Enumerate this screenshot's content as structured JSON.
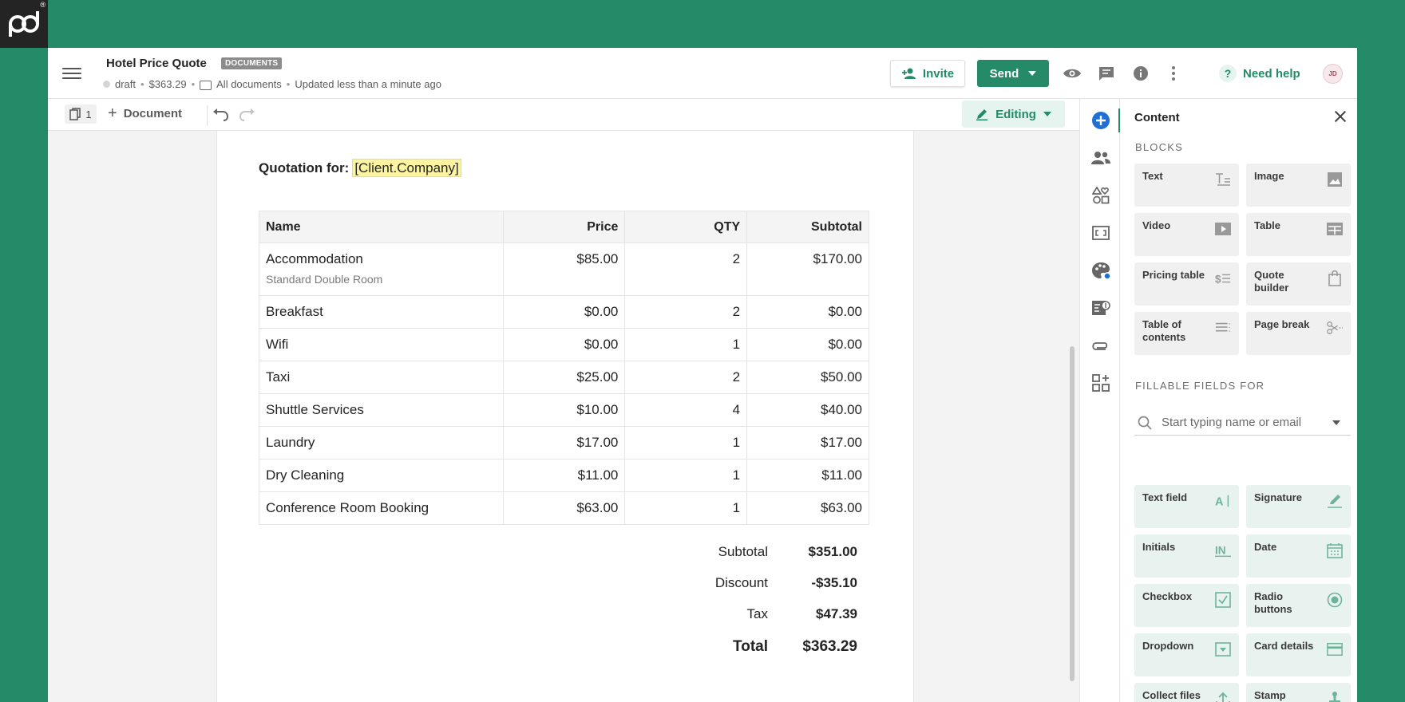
{
  "colors": {
    "brand": "#248A68",
    "brand_light": "#E6F4EF",
    "variable_highlight": "#FDF4A2"
  },
  "header": {
    "title": "Hotel Price Quote",
    "badge": "DOCUMENTS",
    "status": "draft",
    "amount": "$363.29",
    "folder": "All documents",
    "updated": "Updated less than a minute ago",
    "invite_label": "Invite",
    "send_label": "Send",
    "help_label": "Need help",
    "avatar_initials": "JD"
  },
  "toolbar": {
    "page_count": "1",
    "add_document_label": "Document",
    "mode_label": "Editing"
  },
  "document": {
    "quote_label": "Quotation for:",
    "client_variable": "[Client.Company]",
    "columns": [
      "Name",
      "Price",
      "QTY",
      "Subtotal"
    ],
    "rows": [
      {
        "name": "Accommodation",
        "description": "Standard Double Room",
        "price": "$85.00",
        "qty": "2",
        "subtotal": "$170.00"
      },
      {
        "name": "Breakfast",
        "description": "",
        "price": "$0.00",
        "qty": "2",
        "subtotal": "$0.00"
      },
      {
        "name": "Wifi",
        "description": "",
        "price": "$0.00",
        "qty": "1",
        "subtotal": "$0.00"
      },
      {
        "name": "Taxi",
        "description": "",
        "price": "$25.00",
        "qty": "2",
        "subtotal": "$50.00"
      },
      {
        "name": "Shuttle Services",
        "description": "",
        "price": "$10.00",
        "qty": "4",
        "subtotal": "$40.00"
      },
      {
        "name": "Laundry",
        "description": "",
        "price": "$17.00",
        "qty": "1",
        "subtotal": "$17.00"
      },
      {
        "name": "Dry Cleaning",
        "description": "",
        "price": "$11.00",
        "qty": "1",
        "subtotal": "$11.00"
      },
      {
        "name": "Conference Room Booking",
        "description": "",
        "price": "$63.00",
        "qty": "1",
        "subtotal": "$63.00"
      }
    ],
    "totals": {
      "subtotal_label": "Subtotal",
      "subtotal": "$351.00",
      "discount_label": "Discount",
      "discount": "-$35.10",
      "tax_label": "Tax",
      "tax": "$47.39",
      "total_label": "Total",
      "total": "$363.29"
    }
  },
  "panel": {
    "title": "Content",
    "blocks_label": "BLOCKS",
    "blocks": [
      {
        "label": "Text",
        "icon": "text-block-icon"
      },
      {
        "label": "Image",
        "icon": "image-icon"
      },
      {
        "label": "Video",
        "icon": "video-icon"
      },
      {
        "label": "Table",
        "icon": "table-icon"
      },
      {
        "label": "Pricing table",
        "icon": "pricing-table-icon"
      },
      {
        "label": "Quote builder",
        "icon": "quote-builder-icon"
      },
      {
        "label": "Table of contents",
        "icon": "table-of-contents-icon"
      },
      {
        "label": "Page break",
        "icon": "page-break-icon"
      }
    ],
    "fields_label": "FILLABLE FIELDS FOR",
    "recipient_placeholder": "Start typing name or email",
    "fields": [
      {
        "label": "Text field",
        "icon": "text-field-icon"
      },
      {
        "label": "Signature",
        "icon": "signature-icon"
      },
      {
        "label": "Initials",
        "icon": "initials-icon"
      },
      {
        "label": "Date",
        "icon": "calendar-icon"
      },
      {
        "label": "Checkbox",
        "icon": "checkbox-icon"
      },
      {
        "label": "Radio buttons",
        "icon": "radio-icon"
      },
      {
        "label": "Dropdown",
        "icon": "dropdown-icon"
      },
      {
        "label": "Card details",
        "icon": "card-icon"
      },
      {
        "label": "Collect files",
        "icon": "upload-icon"
      },
      {
        "label": "Stamp",
        "icon": "stamp-icon"
      }
    ]
  }
}
